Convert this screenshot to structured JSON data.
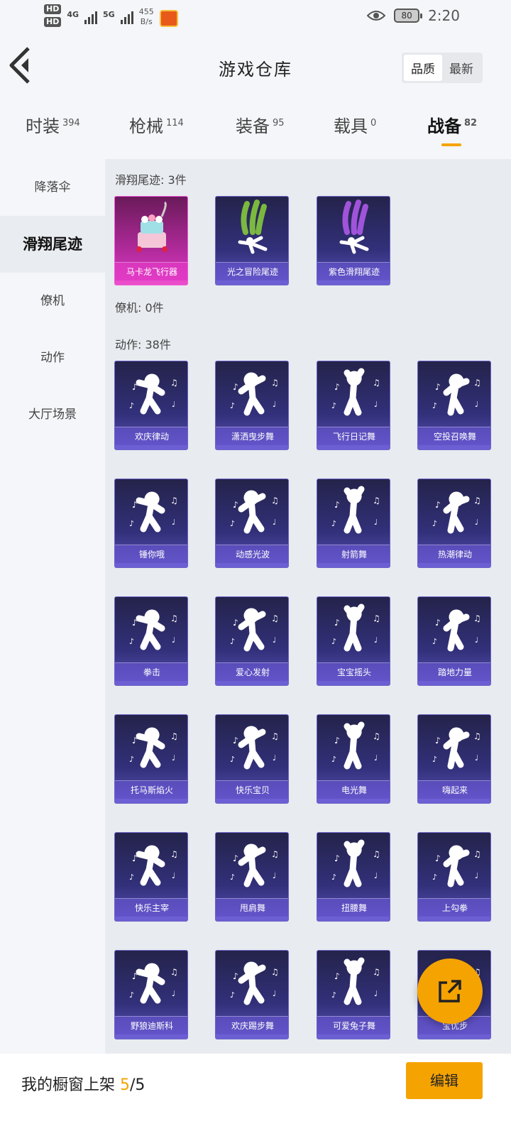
{
  "status_bar": {
    "hd1": "HD",
    "hd2": "HD",
    "net1": "4G",
    "net2": "5G",
    "speed_value": "455",
    "speed_unit": "B/s",
    "battery": "80",
    "time": "2:20"
  },
  "header": {
    "title": "游戏仓库",
    "sort_options": [
      "品质",
      "最新"
    ]
  },
  "category_tabs": [
    {
      "label": "时装",
      "count": "394"
    },
    {
      "label": "枪械",
      "count": "114"
    },
    {
      "label": "装备",
      "count": "95"
    },
    {
      "label": "载具",
      "count": "0"
    },
    {
      "label": "战备",
      "count": "82"
    }
  ],
  "sidebar": {
    "items": [
      "降落伞",
      "滑翔尾迹",
      "僚机",
      "动作",
      "大厅场景"
    ],
    "active": "滑翔尾迹"
  },
  "sections": {
    "trail_title": "滑翔尾迹: 3件",
    "wingman_title": "僚机: 0件",
    "emote_title": "动作: 38件"
  },
  "trail_items": [
    {
      "name": "马卡龙飞行器",
      "icon": "cake-icon",
      "rarity_color": "#e23cc8"
    },
    {
      "name": "光之冒险尾迹",
      "icon": "green-smoke-icon",
      "rarity_color": "#6c5fd4"
    },
    {
      "name": "紫色滑翔尾迹",
      "icon": "purple-smoke-icon",
      "rarity_color": "#6c5fd4"
    }
  ],
  "emote_items": [
    {
      "name": "欢庆律动"
    },
    {
      "name": "潇洒曳步舞"
    },
    {
      "name": "飞行日记舞"
    },
    {
      "name": "空投召唤舞"
    },
    {
      "name": "锤你哦"
    },
    {
      "name": "动感光波"
    },
    {
      "name": "射箭舞"
    },
    {
      "name": "热潮律动"
    },
    {
      "name": "拳击"
    },
    {
      "name": "爱心发射"
    },
    {
      "name": "宝宝摇头"
    },
    {
      "name": "踏地力量"
    },
    {
      "name": "托马斯焰火"
    },
    {
      "name": "快乐宝贝"
    },
    {
      "name": "电光舞"
    },
    {
      "name": "嗨起来"
    },
    {
      "name": "快乐主宰"
    },
    {
      "name": "甩肩舞"
    },
    {
      "name": "扭腰舞"
    },
    {
      "name": "上勾拳"
    },
    {
      "name": "野狼迪斯科"
    },
    {
      "name": "欢庆踢步舞"
    },
    {
      "name": "可爱兔子舞"
    },
    {
      "name": "宝优步"
    }
  ],
  "bottom_bar": {
    "showcase_label": "我的橱窗上架",
    "showcase_count": "5",
    "showcase_total": "/5",
    "edit_label": "编辑"
  },
  "colors": {
    "accent": "#f5a300",
    "card_bg": "#32307a",
    "legendary": "#e23cc8"
  }
}
